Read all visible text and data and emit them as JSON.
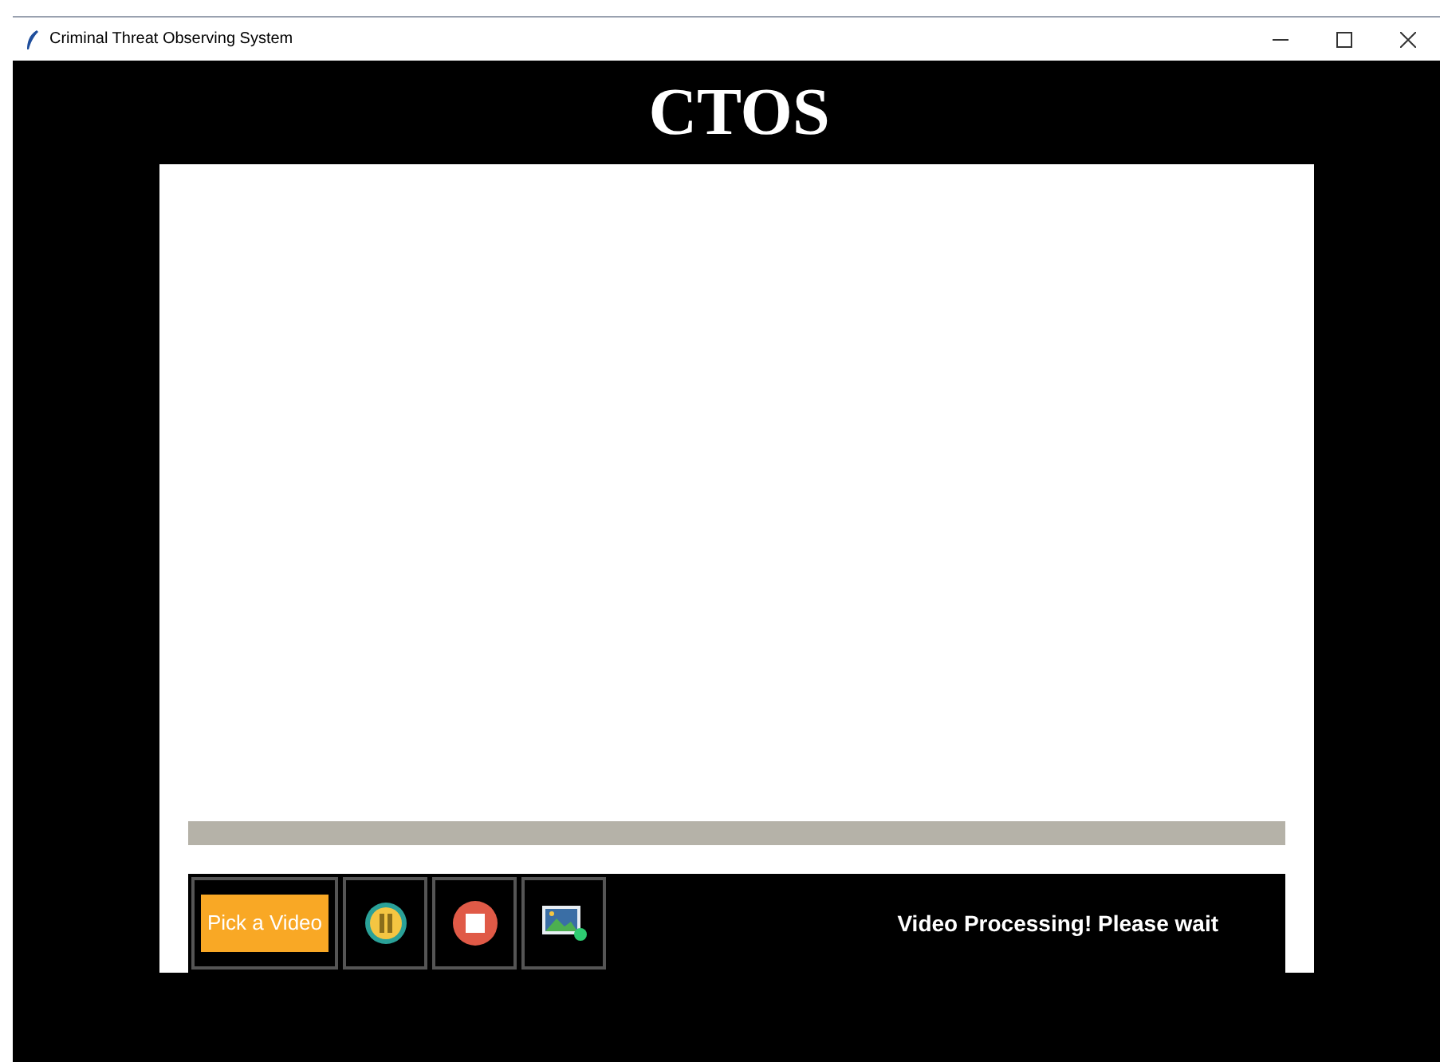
{
  "window": {
    "title": "Criminal Threat Observing System"
  },
  "heading": "CTOS",
  "controls": [
    {
      "kind": "text",
      "label": "Pick a Video"
    },
    {
      "kind": "pause"
    },
    {
      "kind": "stop"
    },
    {
      "kind": "image"
    }
  ],
  "status": "Video Processing! Please wait"
}
